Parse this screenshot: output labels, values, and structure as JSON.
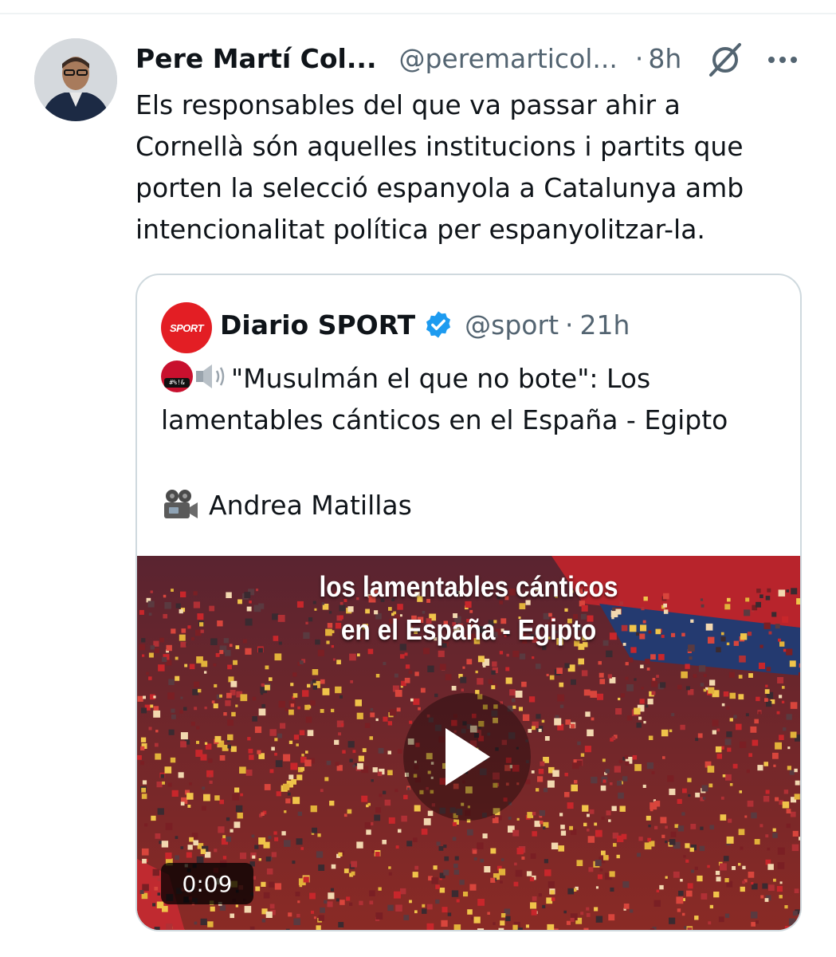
{
  "tweet": {
    "author_name": "Pere Martí Col...",
    "author_handle": "@peremarticol...",
    "separator": "·",
    "time": "8h",
    "text": "Els responsables del que va passar ahir a\nCornellà són aquelles institucions i partits que\nporten la selecció espanyola a Catalunya amb\nintencionalitat política per espanyolitzar-la.",
    "grok_icon": "grok-slash-icon",
    "more_icon": "more-dots-icon"
  },
  "quote": {
    "avatar_text": "SPORT",
    "author_name": "Diario SPORT",
    "verified_icon": "verified-badge-icon",
    "author_handle": "@sport",
    "separator": "·",
    "time": "21h",
    "emoji_1": "angry-face-symbols-icon",
    "emoji_2": "speaker-icon",
    "text": "\"Musulmán el que no bote\": Los lamentables cánticos en el España - Egipto",
    "credit_icon": "movie-camera-icon",
    "credit": "Andrea Matillas",
    "video": {
      "caption_line_1": "los lamentables cánticos",
      "caption_line_2": "en el España - Egipto",
      "duration": "0:09",
      "play_icon": "play-icon"
    }
  },
  "colors": {
    "text": "#0f1419",
    "secondary": "#536471",
    "border": "#cfd9de",
    "verified": "#1d9bf0",
    "sport_red": "#e31e24"
  }
}
